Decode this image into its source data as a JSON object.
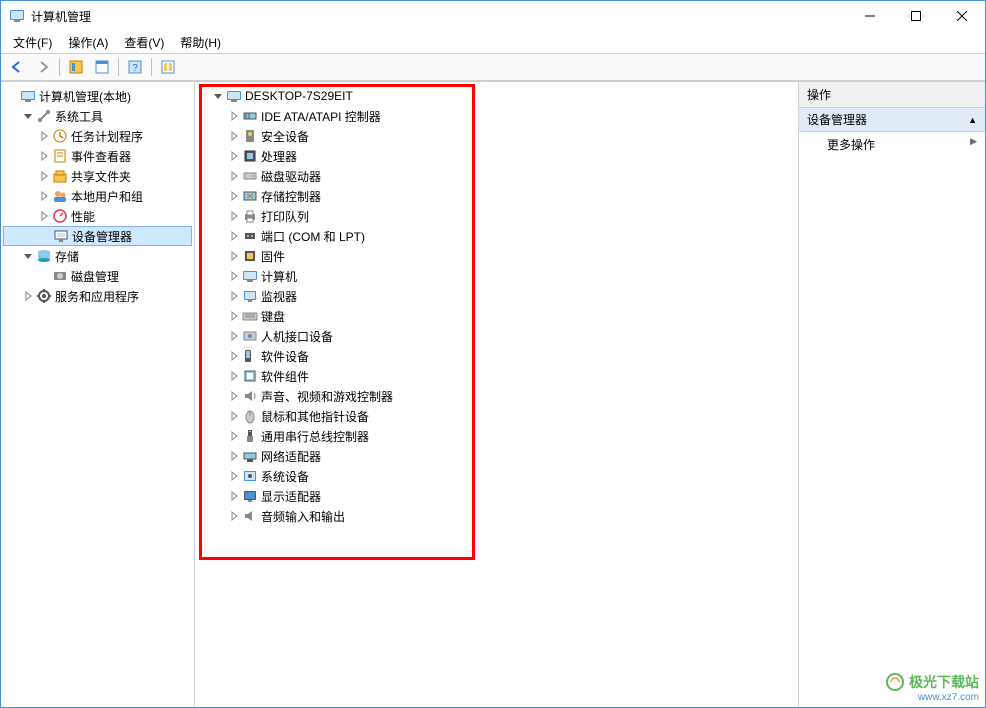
{
  "window": {
    "title": "计算机管理"
  },
  "menu": [
    "文件(F)",
    "操作(A)",
    "查看(V)",
    "帮助(H)"
  ],
  "left_tree": [
    {
      "depth": 0,
      "exp": "none",
      "icon": "computer-mgmt",
      "label": "计算机管理(本地)"
    },
    {
      "depth": 1,
      "exp": "open",
      "icon": "tools",
      "label": "系统工具"
    },
    {
      "depth": 2,
      "exp": "closed",
      "icon": "task",
      "label": "任务计划程序"
    },
    {
      "depth": 2,
      "exp": "closed",
      "icon": "event",
      "label": "事件查看器"
    },
    {
      "depth": 2,
      "exp": "closed",
      "icon": "share",
      "label": "共享文件夹"
    },
    {
      "depth": 2,
      "exp": "closed",
      "icon": "users",
      "label": "本地用户和组"
    },
    {
      "depth": 2,
      "exp": "closed",
      "icon": "perf",
      "label": "性能"
    },
    {
      "depth": 2,
      "exp": "none",
      "icon": "device",
      "label": "设备管理器",
      "selected": true
    },
    {
      "depth": 1,
      "exp": "open",
      "icon": "storage",
      "label": "存储"
    },
    {
      "depth": 2,
      "exp": "none",
      "icon": "disk",
      "label": "磁盘管理"
    },
    {
      "depth": 1,
      "exp": "closed",
      "icon": "services",
      "label": "服务和应用程序"
    }
  ],
  "mid_tree": [
    {
      "depth": 0,
      "exp": "open",
      "icon": "computer",
      "label": "DESKTOP-7S29EIT"
    },
    {
      "depth": 1,
      "exp": "closed",
      "icon": "ide",
      "label": "IDE ATA/ATAPI 控制器"
    },
    {
      "depth": 1,
      "exp": "closed",
      "icon": "security-dev",
      "label": "安全设备"
    },
    {
      "depth": 1,
      "exp": "closed",
      "icon": "cpu",
      "label": "处理器"
    },
    {
      "depth": 1,
      "exp": "closed",
      "icon": "diskdrive",
      "label": "磁盘驱动器"
    },
    {
      "depth": 1,
      "exp": "closed",
      "icon": "storage-ctl",
      "label": "存储控制器"
    },
    {
      "depth": 1,
      "exp": "closed",
      "icon": "printer",
      "label": "打印队列"
    },
    {
      "depth": 1,
      "exp": "closed",
      "icon": "port",
      "label": "端口 (COM 和 LPT)"
    },
    {
      "depth": 1,
      "exp": "closed",
      "icon": "firmware",
      "label": "固件"
    },
    {
      "depth": 1,
      "exp": "closed",
      "icon": "computer",
      "label": "计算机"
    },
    {
      "depth": 1,
      "exp": "closed",
      "icon": "monitor",
      "label": "监视器"
    },
    {
      "depth": 1,
      "exp": "closed",
      "icon": "keyboard",
      "label": "键盘"
    },
    {
      "depth": 1,
      "exp": "closed",
      "icon": "hid",
      "label": "人机接口设备"
    },
    {
      "depth": 1,
      "exp": "closed",
      "icon": "softdev",
      "label": "软件设备"
    },
    {
      "depth": 1,
      "exp": "closed",
      "icon": "softcomp",
      "label": "软件组件"
    },
    {
      "depth": 1,
      "exp": "closed",
      "icon": "audio",
      "label": "声音、视频和游戏控制器"
    },
    {
      "depth": 1,
      "exp": "closed",
      "icon": "mouse",
      "label": "鼠标和其他指针设备"
    },
    {
      "depth": 1,
      "exp": "closed",
      "icon": "usb",
      "label": "通用串行总线控制器"
    },
    {
      "depth": 1,
      "exp": "closed",
      "icon": "network",
      "label": "网络适配器"
    },
    {
      "depth": 1,
      "exp": "closed",
      "icon": "system-dev",
      "label": "系统设备"
    },
    {
      "depth": 1,
      "exp": "closed",
      "icon": "display",
      "label": "显示适配器"
    },
    {
      "depth": 1,
      "exp": "closed",
      "icon": "audio-io",
      "label": "音频输入和输出"
    }
  ],
  "right": {
    "header": "操作",
    "section": "设备管理器",
    "item": "更多操作"
  },
  "watermark": {
    "line1": "极光下载站",
    "line2": "www.xz7.com"
  }
}
